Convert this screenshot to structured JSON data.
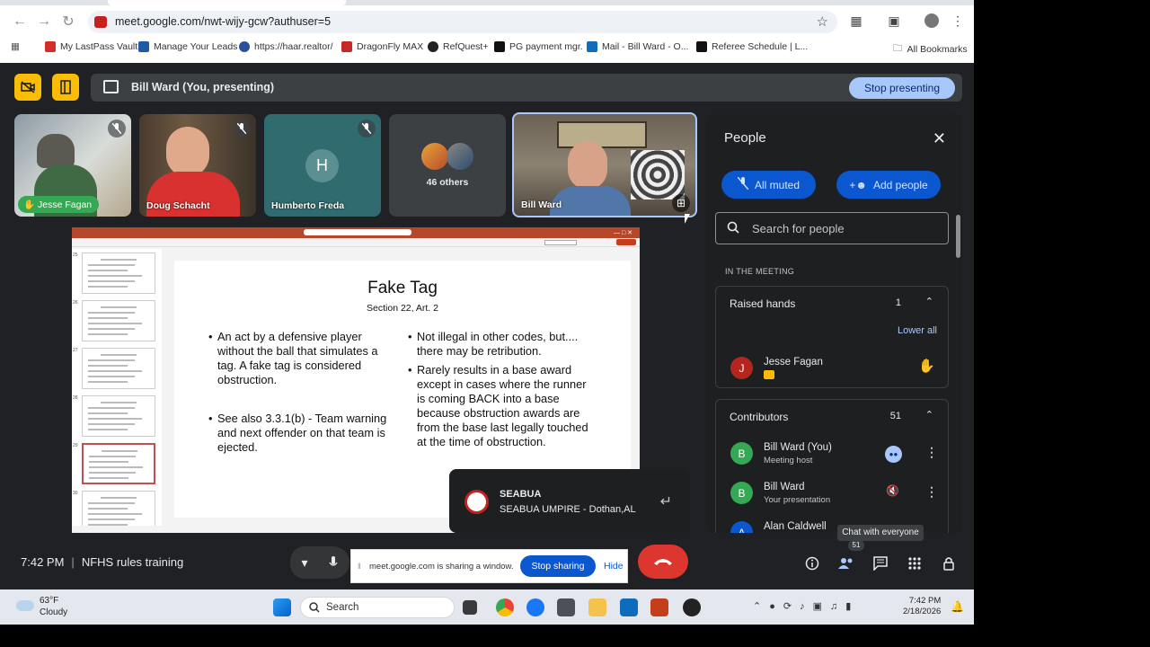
{
  "browser": {
    "url": "meet.google.com/nwt-wijy-gcw?authuser=5",
    "bookmarks": [
      {
        "label": "My LastPass Vault",
        "color": "#d32d27"
      },
      {
        "label": "Manage Your Leads",
        "color": "#1e5aa8"
      },
      {
        "label": "https://haar.realtor/",
        "color": "#2b4f9b"
      },
      {
        "label": "DragonFly MAX",
        "color": "#c62828"
      },
      {
        "label": "RefQuest+",
        "color": "#222222"
      },
      {
        "label": "PG payment mgr.",
        "color": "#111111"
      },
      {
        "label": "Mail - Bill Ward - O...",
        "color": "#0f6cbd"
      },
      {
        "label": "Referee Schedule | L...",
        "color": "#111111"
      }
    ],
    "all_bookmarks": "All Bookmarks"
  },
  "meet": {
    "presenting_label": "Bill Ward (You, presenting)",
    "stop_presenting": "Stop presenting",
    "tiles": [
      {
        "name": "Jesse Fagan",
        "muted": true
      },
      {
        "name": "Doug Schacht",
        "muted": true
      },
      {
        "name": "Humberto Freda",
        "initial": "H",
        "muted": true
      },
      {
        "name": "46 others"
      },
      {
        "name": "Bill Ward"
      }
    ],
    "people_panel": {
      "title": "People",
      "all_muted": "All muted",
      "add_people": "Add people",
      "search_placeholder": "Search for people",
      "in_meeting": "IN THE MEETING",
      "raised_hands": {
        "label": "Raised hands",
        "count": "1",
        "lower_all": "Lower all",
        "person": {
          "name": "Jesse Fagan",
          "initial": "J"
        }
      },
      "contributors": {
        "label": "Contributors",
        "count": "51",
        "people": [
          {
            "name": "Bill Ward (You)",
            "sub": "Meeting host",
            "initial": "B"
          },
          {
            "name": "Bill Ward",
            "sub": "Your presentation",
            "initial": "B"
          },
          {
            "name": "Alan Caldwell",
            "initial": "A"
          }
        ]
      }
    },
    "slide": {
      "title": "Fake Tag",
      "subtitle": "Section 22, Art. 2",
      "bullets_left": [
        "An act by a defensive player without the ball that simulates a tag.  A fake tag is considered obstruction.",
        "See also 3.3.1(b)  - Team warning and next offender on that team is ejected."
      ],
      "bullets_right": [
        "Not illegal in other codes, but.... there may be retribution.",
        "Rarely results in a base award except in cases where the runner is coming BACK into a base because obstruction awards are from the base last legally touched at the time of obstruction."
      ],
      "thumb_numbers": [
        "25",
        "26",
        "27",
        "28",
        "29",
        "30"
      ]
    },
    "toast": {
      "title": "SEABUA",
      "subtitle": "SEABUA UMPIRE - Dothan,AL"
    },
    "time": "7:42 PM",
    "meeting_name": "NFHS rules training",
    "share_bar": {
      "text": "meet.google.com is sharing a window.",
      "stop": "Stop sharing",
      "hide": "Hide"
    },
    "tooltip": "Chat with everyone",
    "people_badge": "51"
  },
  "taskbar": {
    "temp": "63°F",
    "condition": "Cloudy",
    "search": "Search",
    "clock_time": "7:42 PM",
    "clock_date": "2/18/2026"
  }
}
